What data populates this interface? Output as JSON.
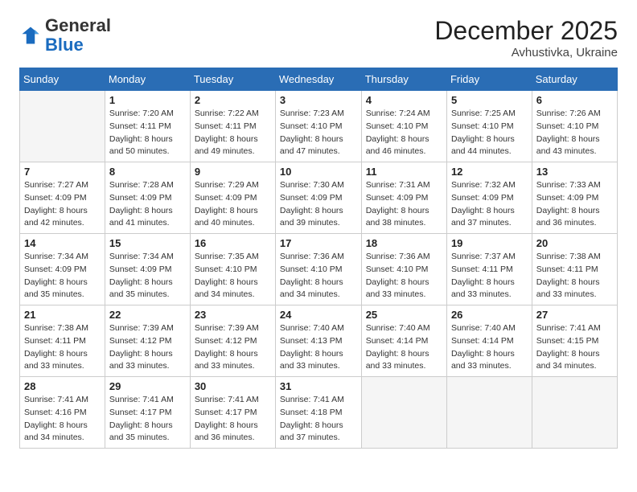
{
  "header": {
    "logo_general": "General",
    "logo_blue": "Blue",
    "month_title": "December 2025",
    "location": "Avhustivka, Ukraine"
  },
  "columns": [
    "Sunday",
    "Monday",
    "Tuesday",
    "Wednesday",
    "Thursday",
    "Friday",
    "Saturday"
  ],
  "weeks": [
    [
      {
        "day": "",
        "info": ""
      },
      {
        "day": "1",
        "info": "Sunrise: 7:20 AM\nSunset: 4:11 PM\nDaylight: 8 hours\nand 50 minutes."
      },
      {
        "day": "2",
        "info": "Sunrise: 7:22 AM\nSunset: 4:11 PM\nDaylight: 8 hours\nand 49 minutes."
      },
      {
        "day": "3",
        "info": "Sunrise: 7:23 AM\nSunset: 4:10 PM\nDaylight: 8 hours\nand 47 minutes."
      },
      {
        "day": "4",
        "info": "Sunrise: 7:24 AM\nSunset: 4:10 PM\nDaylight: 8 hours\nand 46 minutes."
      },
      {
        "day": "5",
        "info": "Sunrise: 7:25 AM\nSunset: 4:10 PM\nDaylight: 8 hours\nand 44 minutes."
      },
      {
        "day": "6",
        "info": "Sunrise: 7:26 AM\nSunset: 4:10 PM\nDaylight: 8 hours\nand 43 minutes."
      }
    ],
    [
      {
        "day": "7",
        "info": "Sunrise: 7:27 AM\nSunset: 4:09 PM\nDaylight: 8 hours\nand 42 minutes."
      },
      {
        "day": "8",
        "info": "Sunrise: 7:28 AM\nSunset: 4:09 PM\nDaylight: 8 hours\nand 41 minutes."
      },
      {
        "day": "9",
        "info": "Sunrise: 7:29 AM\nSunset: 4:09 PM\nDaylight: 8 hours\nand 40 minutes."
      },
      {
        "day": "10",
        "info": "Sunrise: 7:30 AM\nSunset: 4:09 PM\nDaylight: 8 hours\nand 39 minutes."
      },
      {
        "day": "11",
        "info": "Sunrise: 7:31 AM\nSunset: 4:09 PM\nDaylight: 8 hours\nand 38 minutes."
      },
      {
        "day": "12",
        "info": "Sunrise: 7:32 AM\nSunset: 4:09 PM\nDaylight: 8 hours\nand 37 minutes."
      },
      {
        "day": "13",
        "info": "Sunrise: 7:33 AM\nSunset: 4:09 PM\nDaylight: 8 hours\nand 36 minutes."
      }
    ],
    [
      {
        "day": "14",
        "info": "Sunrise: 7:34 AM\nSunset: 4:09 PM\nDaylight: 8 hours\nand 35 minutes."
      },
      {
        "day": "15",
        "info": "Sunrise: 7:34 AM\nSunset: 4:09 PM\nDaylight: 8 hours\nand 35 minutes."
      },
      {
        "day": "16",
        "info": "Sunrise: 7:35 AM\nSunset: 4:10 PM\nDaylight: 8 hours\nand 34 minutes."
      },
      {
        "day": "17",
        "info": "Sunrise: 7:36 AM\nSunset: 4:10 PM\nDaylight: 8 hours\nand 34 minutes."
      },
      {
        "day": "18",
        "info": "Sunrise: 7:36 AM\nSunset: 4:10 PM\nDaylight: 8 hours\nand 33 minutes."
      },
      {
        "day": "19",
        "info": "Sunrise: 7:37 AM\nSunset: 4:11 PM\nDaylight: 8 hours\nand 33 minutes."
      },
      {
        "day": "20",
        "info": "Sunrise: 7:38 AM\nSunset: 4:11 PM\nDaylight: 8 hours\nand 33 minutes."
      }
    ],
    [
      {
        "day": "21",
        "info": "Sunrise: 7:38 AM\nSunset: 4:11 PM\nDaylight: 8 hours\nand 33 minutes."
      },
      {
        "day": "22",
        "info": "Sunrise: 7:39 AM\nSunset: 4:12 PM\nDaylight: 8 hours\nand 33 minutes."
      },
      {
        "day": "23",
        "info": "Sunrise: 7:39 AM\nSunset: 4:12 PM\nDaylight: 8 hours\nand 33 minutes."
      },
      {
        "day": "24",
        "info": "Sunrise: 7:40 AM\nSunset: 4:13 PM\nDaylight: 8 hours\nand 33 minutes."
      },
      {
        "day": "25",
        "info": "Sunrise: 7:40 AM\nSunset: 4:14 PM\nDaylight: 8 hours\nand 33 minutes."
      },
      {
        "day": "26",
        "info": "Sunrise: 7:40 AM\nSunset: 4:14 PM\nDaylight: 8 hours\nand 33 minutes."
      },
      {
        "day": "27",
        "info": "Sunrise: 7:41 AM\nSunset: 4:15 PM\nDaylight: 8 hours\nand 34 minutes."
      }
    ],
    [
      {
        "day": "28",
        "info": "Sunrise: 7:41 AM\nSunset: 4:16 PM\nDaylight: 8 hours\nand 34 minutes."
      },
      {
        "day": "29",
        "info": "Sunrise: 7:41 AM\nSunset: 4:17 PM\nDaylight: 8 hours\nand 35 minutes."
      },
      {
        "day": "30",
        "info": "Sunrise: 7:41 AM\nSunset: 4:17 PM\nDaylight: 8 hours\nand 36 minutes."
      },
      {
        "day": "31",
        "info": "Sunrise: 7:41 AM\nSunset: 4:18 PM\nDaylight: 8 hours\nand 37 minutes."
      },
      {
        "day": "",
        "info": ""
      },
      {
        "day": "",
        "info": ""
      },
      {
        "day": "",
        "info": ""
      }
    ]
  ]
}
